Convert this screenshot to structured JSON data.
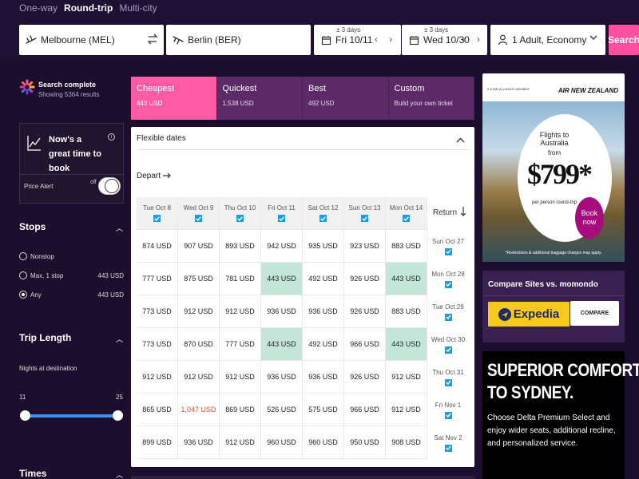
{
  "trip_types": [
    {
      "label": "One-way",
      "active": false
    },
    {
      "label": "Round-trip",
      "active": true
    },
    {
      "label": "Multi-city",
      "active": false
    }
  ],
  "search": {
    "origin": "Melbourne (MEL)",
    "destination": "Berlin (BER)",
    "depart_flex": "± 3 days",
    "depart_date": "Fri 10/11",
    "return_flex": "± 3 days",
    "return_date": "Wed 10/30",
    "travelers": "1 Adult, Economy",
    "button": "Search"
  },
  "status": {
    "title": "Search complete",
    "subtitle": "Showing 5364 results"
  },
  "price_alert": {
    "headline": "Now's a great time to book",
    "info": "i",
    "label": "Price Alert",
    "toggle_text": "off"
  },
  "filters": {
    "stops_title": "Stops",
    "stops": [
      {
        "label": "Nonstop",
        "price": "",
        "selected": false
      },
      {
        "label": "Max. 1 stop",
        "price": "443 USD",
        "selected": false
      },
      {
        "label": "Any",
        "price": "443 USD",
        "selected": true
      }
    ],
    "trip_length_title": "Trip Length",
    "nights_label": "Nights at destination",
    "range_min": "11",
    "range_max": "25",
    "times_title": "Times"
  },
  "sort_tabs": [
    {
      "title": "Cheapest",
      "price": "443 USD",
      "active": true
    },
    {
      "title": "Quickest",
      "price": "1,538 USD",
      "active": false
    },
    {
      "title": "Best",
      "price": "492 USD",
      "active": false
    },
    {
      "title": "Custom",
      "price": "Build your own ticket",
      "active": false
    }
  ],
  "flex_dates": {
    "title": "Flexible dates",
    "depart_label": "Depart",
    "return_label": "Return",
    "depart_days": [
      "Tue Oct 8",
      "Wed Oct 9",
      "Thu Oct 10",
      "Fri Oct 11",
      "Sat Oct 12",
      "Sun Oct 13",
      "Mon Oct 14"
    ],
    "return_days": [
      "Sun Oct 27",
      "Mon Oct 28",
      "Tue Oct 29",
      "Wed Oct 30",
      "Thu Oct 31",
      "Fri Nov 1",
      "Sat Nov 2"
    ],
    "rows": [
      [
        {
          "v": "874 USD"
        },
        {
          "v": "907 USD"
        },
        {
          "v": "893 USD"
        },
        {
          "v": "942 USD"
        },
        {
          "v": "935 USD"
        },
        {
          "v": "923 USD"
        },
        {
          "v": "883 USD"
        }
      ],
      [
        {
          "v": "777 USD"
        },
        {
          "v": "875 USD"
        },
        {
          "v": "781 USD"
        },
        {
          "v": "443 USD",
          "hi": true
        },
        {
          "v": "492 USD"
        },
        {
          "v": "926 USD"
        },
        {
          "v": "443 USD",
          "hi": true
        }
      ],
      [
        {
          "v": "773 USD"
        },
        {
          "v": "912 USD"
        },
        {
          "v": "912 USD"
        },
        {
          "v": "936 USD"
        },
        {
          "v": "936 USD"
        },
        {
          "v": "926 USD"
        },
        {
          "v": "883 USD"
        }
      ],
      [
        {
          "v": "773 USD"
        },
        {
          "v": "870 USD"
        },
        {
          "v": "777 USD"
        },
        {
          "v": "443 USD",
          "hi": true
        },
        {
          "v": "492 USD"
        },
        {
          "v": "966 USD"
        },
        {
          "v": "443 USD",
          "hi": true
        }
      ],
      [
        {
          "v": "912 USD"
        },
        {
          "v": "912 USD"
        },
        {
          "v": "912 USD"
        },
        {
          "v": "936 USD"
        },
        {
          "v": "936 USD"
        },
        {
          "v": "926 USD"
        },
        {
          "v": "912 USD"
        }
      ],
      [
        {
          "v": "865 USD"
        },
        {
          "v": "1,047 USD",
          "red": true
        },
        {
          "v": "869 USD"
        },
        {
          "v": "526 USD"
        },
        {
          "v": "575 USD"
        },
        {
          "v": "966 USD"
        },
        {
          "v": "912 USD"
        }
      ],
      [
        {
          "v": "899 USD"
        },
        {
          "v": "936 USD"
        },
        {
          "v": "912 USD"
        },
        {
          "v": "960 USD"
        },
        {
          "v": "960 USD"
        },
        {
          "v": "950 USD"
        },
        {
          "v": "908 USD"
        }
      ]
    ]
  },
  "ad_airnz": {
    "alliance": "A STAR ALLIANCE MEMBER",
    "brand": "AIR NEW ZEALAND",
    "headline": "Flights to Australia",
    "from": "from",
    "price": "$799*",
    "per_person": "per person round-trip",
    "cta": "Book now",
    "disclaimer": "*Restrictions & additional baggage charges may apply."
  },
  "compare": {
    "title": "Compare Sites vs. momondo",
    "partner": "Expedia",
    "button": "COMPARE"
  },
  "ad_delta": {
    "headline_1": "SUPERIOR COMFORT",
    "headline_2": "TO SYDNEY.",
    "body": "Choose Delta Premium Select and enjoy wider seats, additional recline, and personalized service."
  },
  "colors": {
    "background": "#1c0f2e",
    "accent_pink": "#ff4fa0",
    "tab_purple": "#5d2a68",
    "highlight_green": "#c3e6d8",
    "checkbox_blue": "#1f9be0",
    "slider_blue": "#3f8ef0"
  }
}
